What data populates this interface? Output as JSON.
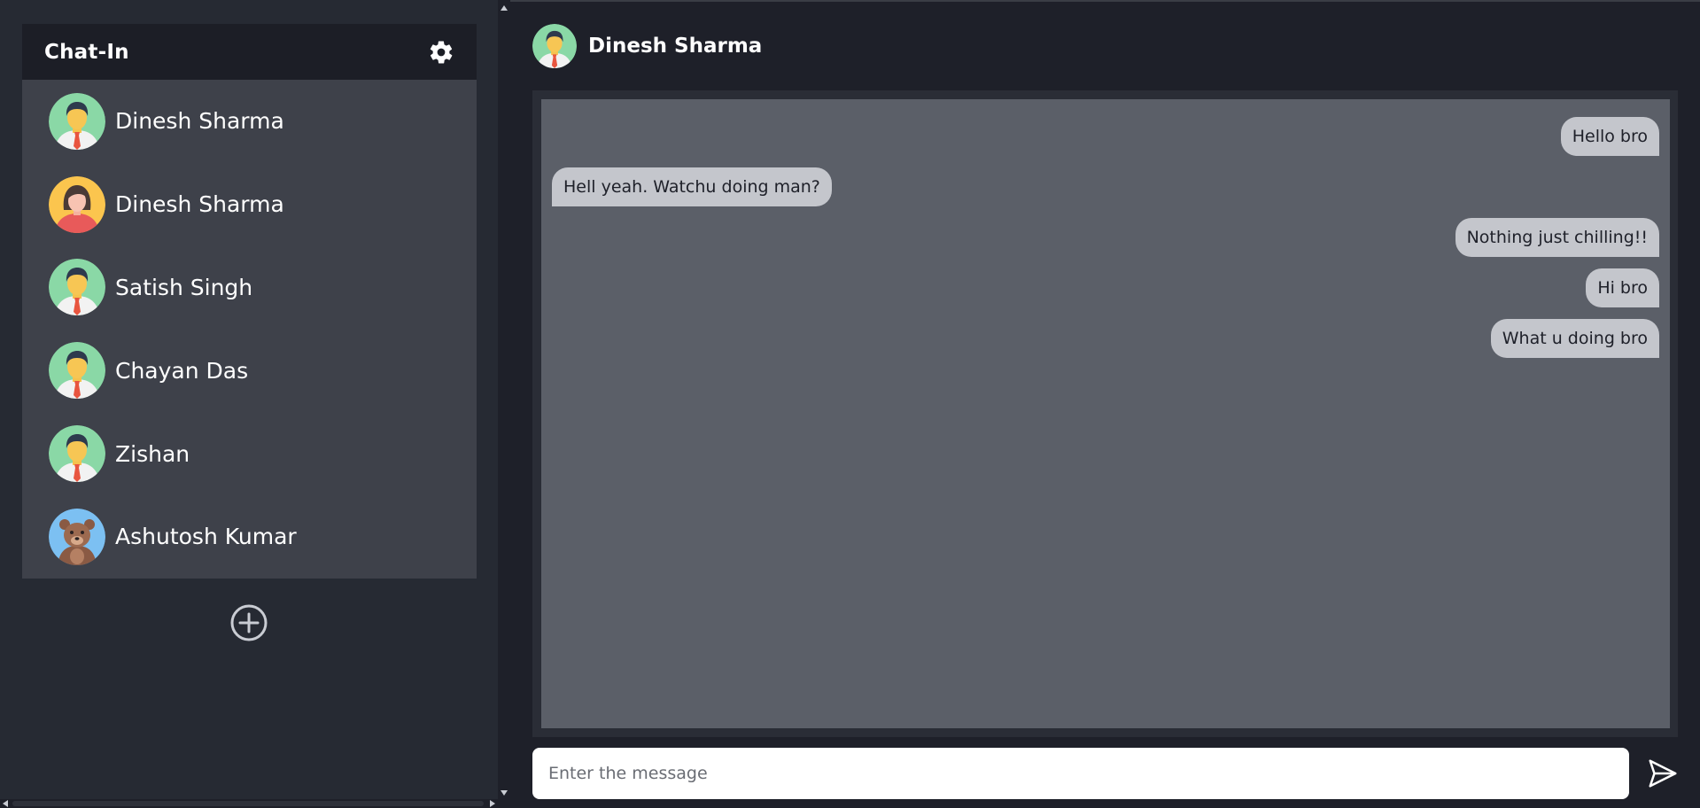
{
  "sidebar": {
    "title": "Chat-In",
    "settings_icon": "gear-icon",
    "add_icon": "plus-circle-icon",
    "contacts": [
      {
        "name": "Dinesh Sharma",
        "avatar": "man-avatar"
      },
      {
        "name": "Dinesh Sharma",
        "avatar": "woman-avatar"
      },
      {
        "name": "Satish Singh",
        "avatar": "man-avatar"
      },
      {
        "name": "Chayan Das",
        "avatar": "man-avatar"
      },
      {
        "name": "Zishan",
        "avatar": "man-avatar"
      },
      {
        "name": "Ashutosh Kumar",
        "avatar": "bear-avatar"
      }
    ]
  },
  "chat": {
    "contact_name": "Dinesh Sharma",
    "avatar": "man-avatar",
    "messages": [
      {
        "text": "Hello bro",
        "direction": "sent"
      },
      {
        "text": "Hell yeah. Watchu doing man?",
        "direction": "received"
      },
      {
        "text": "Nothing just chilling!!",
        "direction": "sent"
      },
      {
        "text": "Hi bro",
        "direction": "sent"
      },
      {
        "text": "What u doing bro",
        "direction": "sent"
      }
    ]
  },
  "composer": {
    "placeholder": "Enter the message",
    "value": "",
    "send_icon": "send-icon"
  },
  "colors": {
    "background": "#1e2029",
    "sidebar": "#262a33",
    "contact_list": "#3e414a",
    "chat_panel": "#5b5f68",
    "bubble": "#c4c6cc"
  }
}
